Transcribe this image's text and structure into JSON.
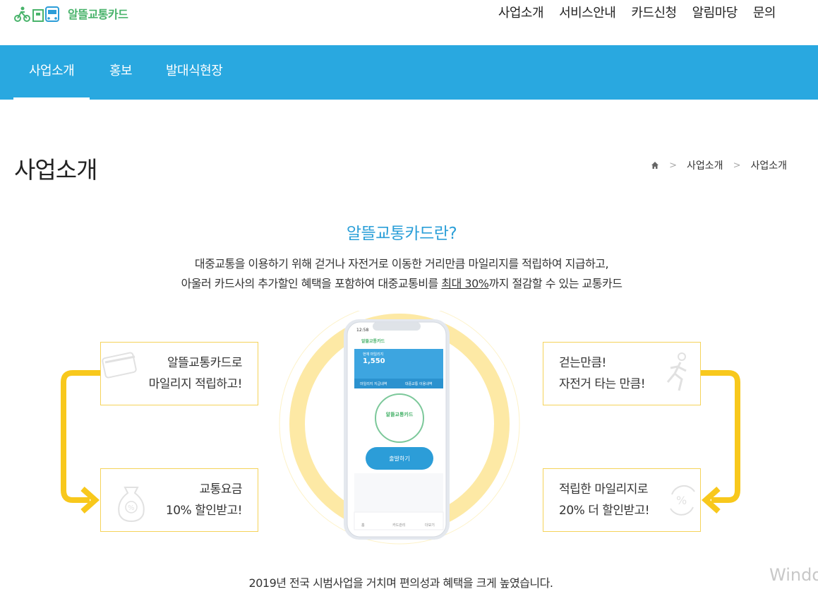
{
  "logo": {
    "text": "알뜰교통카드"
  },
  "gnb": {
    "items": [
      "사업소개",
      "서비스안내",
      "카드신청",
      "알림마당",
      "문의"
    ]
  },
  "subnav": {
    "tabs": [
      "사업소개",
      "홍보",
      "발대식현장"
    ]
  },
  "page": {
    "title": "사업소개"
  },
  "breadcrumb": {
    "items": [
      "사업소개",
      "사업소개"
    ]
  },
  "intro": {
    "title": "알뜰교통카드란?",
    "line1": "대중교통을 이용하기 위해 걷거나 자전거로 이동한 거리만큼 마일리지를 적립하여 지급하고,",
    "line2_prefix": "아울러 카드사의 추가할인 혜택을 포함하여 대중교통비를 ",
    "line2_highlight": "최대 30%",
    "line2_suffix": "까지 절감할 수 있는 교통카드"
  },
  "boxes": {
    "top_left": {
      "line1": "알뜰교통카드로",
      "line2": "마일리지 적립하고!"
    },
    "bottom_left": {
      "line1": "교통요금",
      "line2": "10% 할인받고!"
    },
    "top_right": {
      "line1": "걷는만큼!",
      "line2": "자전거 타는 만큼!"
    },
    "bottom_right": {
      "line1": "적립한 마일리지로",
      "line2": "20% 더 할인받고!"
    }
  },
  "phone": {
    "time": "12:58",
    "app_name": "알뜰교통카드",
    "mileage_label": "현재 마일리지",
    "mileage_value": "1,550",
    "tab_mileage": "마일리지 지급내역",
    "tab_usage": "대중교통 이용내역",
    "start_button": "출발하기",
    "nav_home": "홈",
    "nav_card": "카드관리",
    "nav_more": "더보기"
  },
  "bottom": {
    "text": "2019년 전국 시범사업을 거치며 편의성과 혜택을 크게 높였습니다."
  },
  "watermark": {
    "text": "Windo"
  },
  "colors": {
    "brand_blue": "#29a8e0",
    "title_blue": "#2b9fd8",
    "accent_yellow": "#f8c81c",
    "logo_green": "#49b36b"
  }
}
